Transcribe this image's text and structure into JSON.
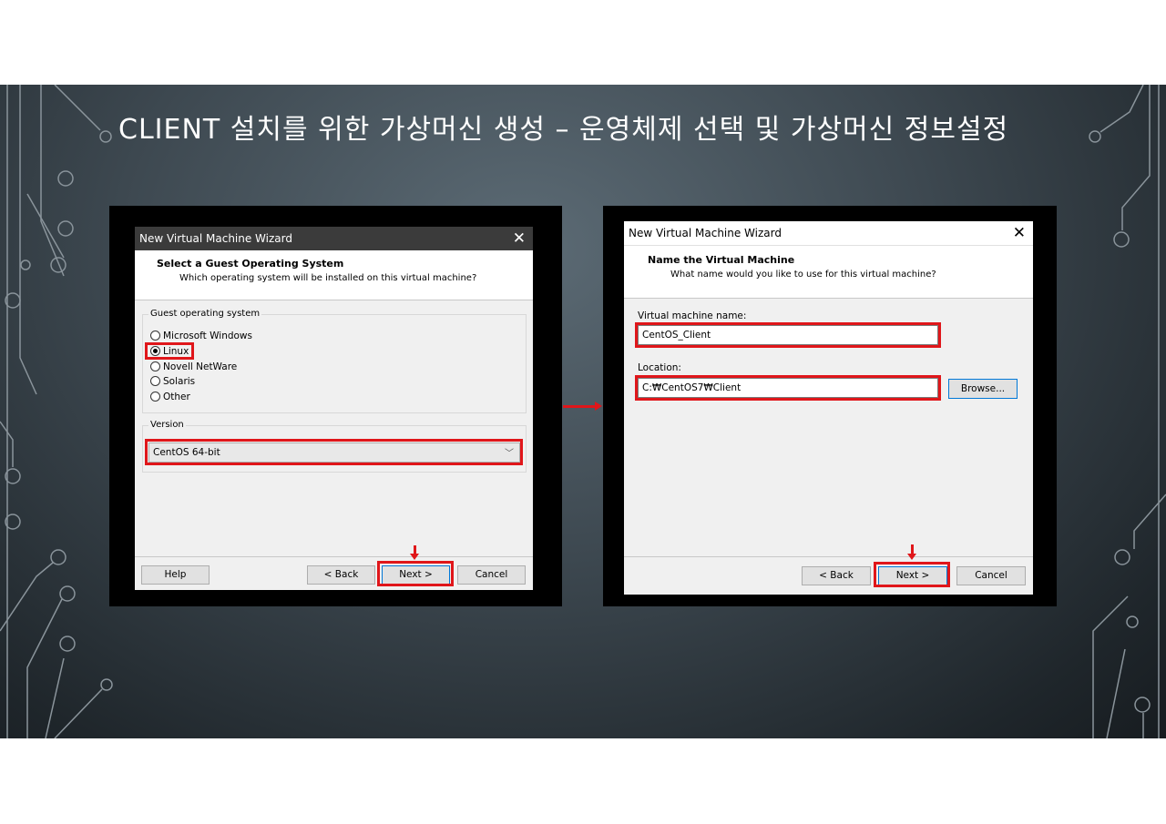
{
  "slide": {
    "title": "CLIENT 설치를 위한 가상머신 생성 – 운영체제 선택 및 가상머신 정보설정"
  },
  "wizard1": {
    "window_title": "New Virtual Machine Wizard",
    "close": "✕",
    "header_title": "Select a Guest Operating System",
    "header_subtitle": "Which operating system will be installed on this virtual machine?",
    "guest_group_label": "Guest operating system",
    "os_options": [
      {
        "label": "Microsoft Windows",
        "selected": false
      },
      {
        "label": "Linux",
        "selected": true
      },
      {
        "label": "Novell NetWare",
        "selected": false
      },
      {
        "label": "Solaris",
        "selected": false
      },
      {
        "label": "Other",
        "selected": false
      }
    ],
    "version_group_label": "Version",
    "version_value": "CentOS 64-bit",
    "version_arrow": "﹀",
    "buttons": {
      "help": "Help",
      "back": "< Back",
      "next": "Next >",
      "cancel": "Cancel"
    }
  },
  "wizard2": {
    "window_title": "New Virtual Machine Wizard",
    "close": "✕",
    "header_title": "Name the Virtual Machine",
    "header_subtitle": "What name would you like to use for this virtual machine?",
    "name_label": "Virtual machine name:",
    "name_value": "CentOS_Client",
    "location_label": "Location:",
    "location_value": "C:₩CentOS7₩Client",
    "browse": "Browse...",
    "buttons": {
      "back": "< Back",
      "next": "Next >",
      "cancel": "Cancel"
    }
  },
  "colors": {
    "highlight": "#e0161a",
    "focus": "#0078d7"
  }
}
